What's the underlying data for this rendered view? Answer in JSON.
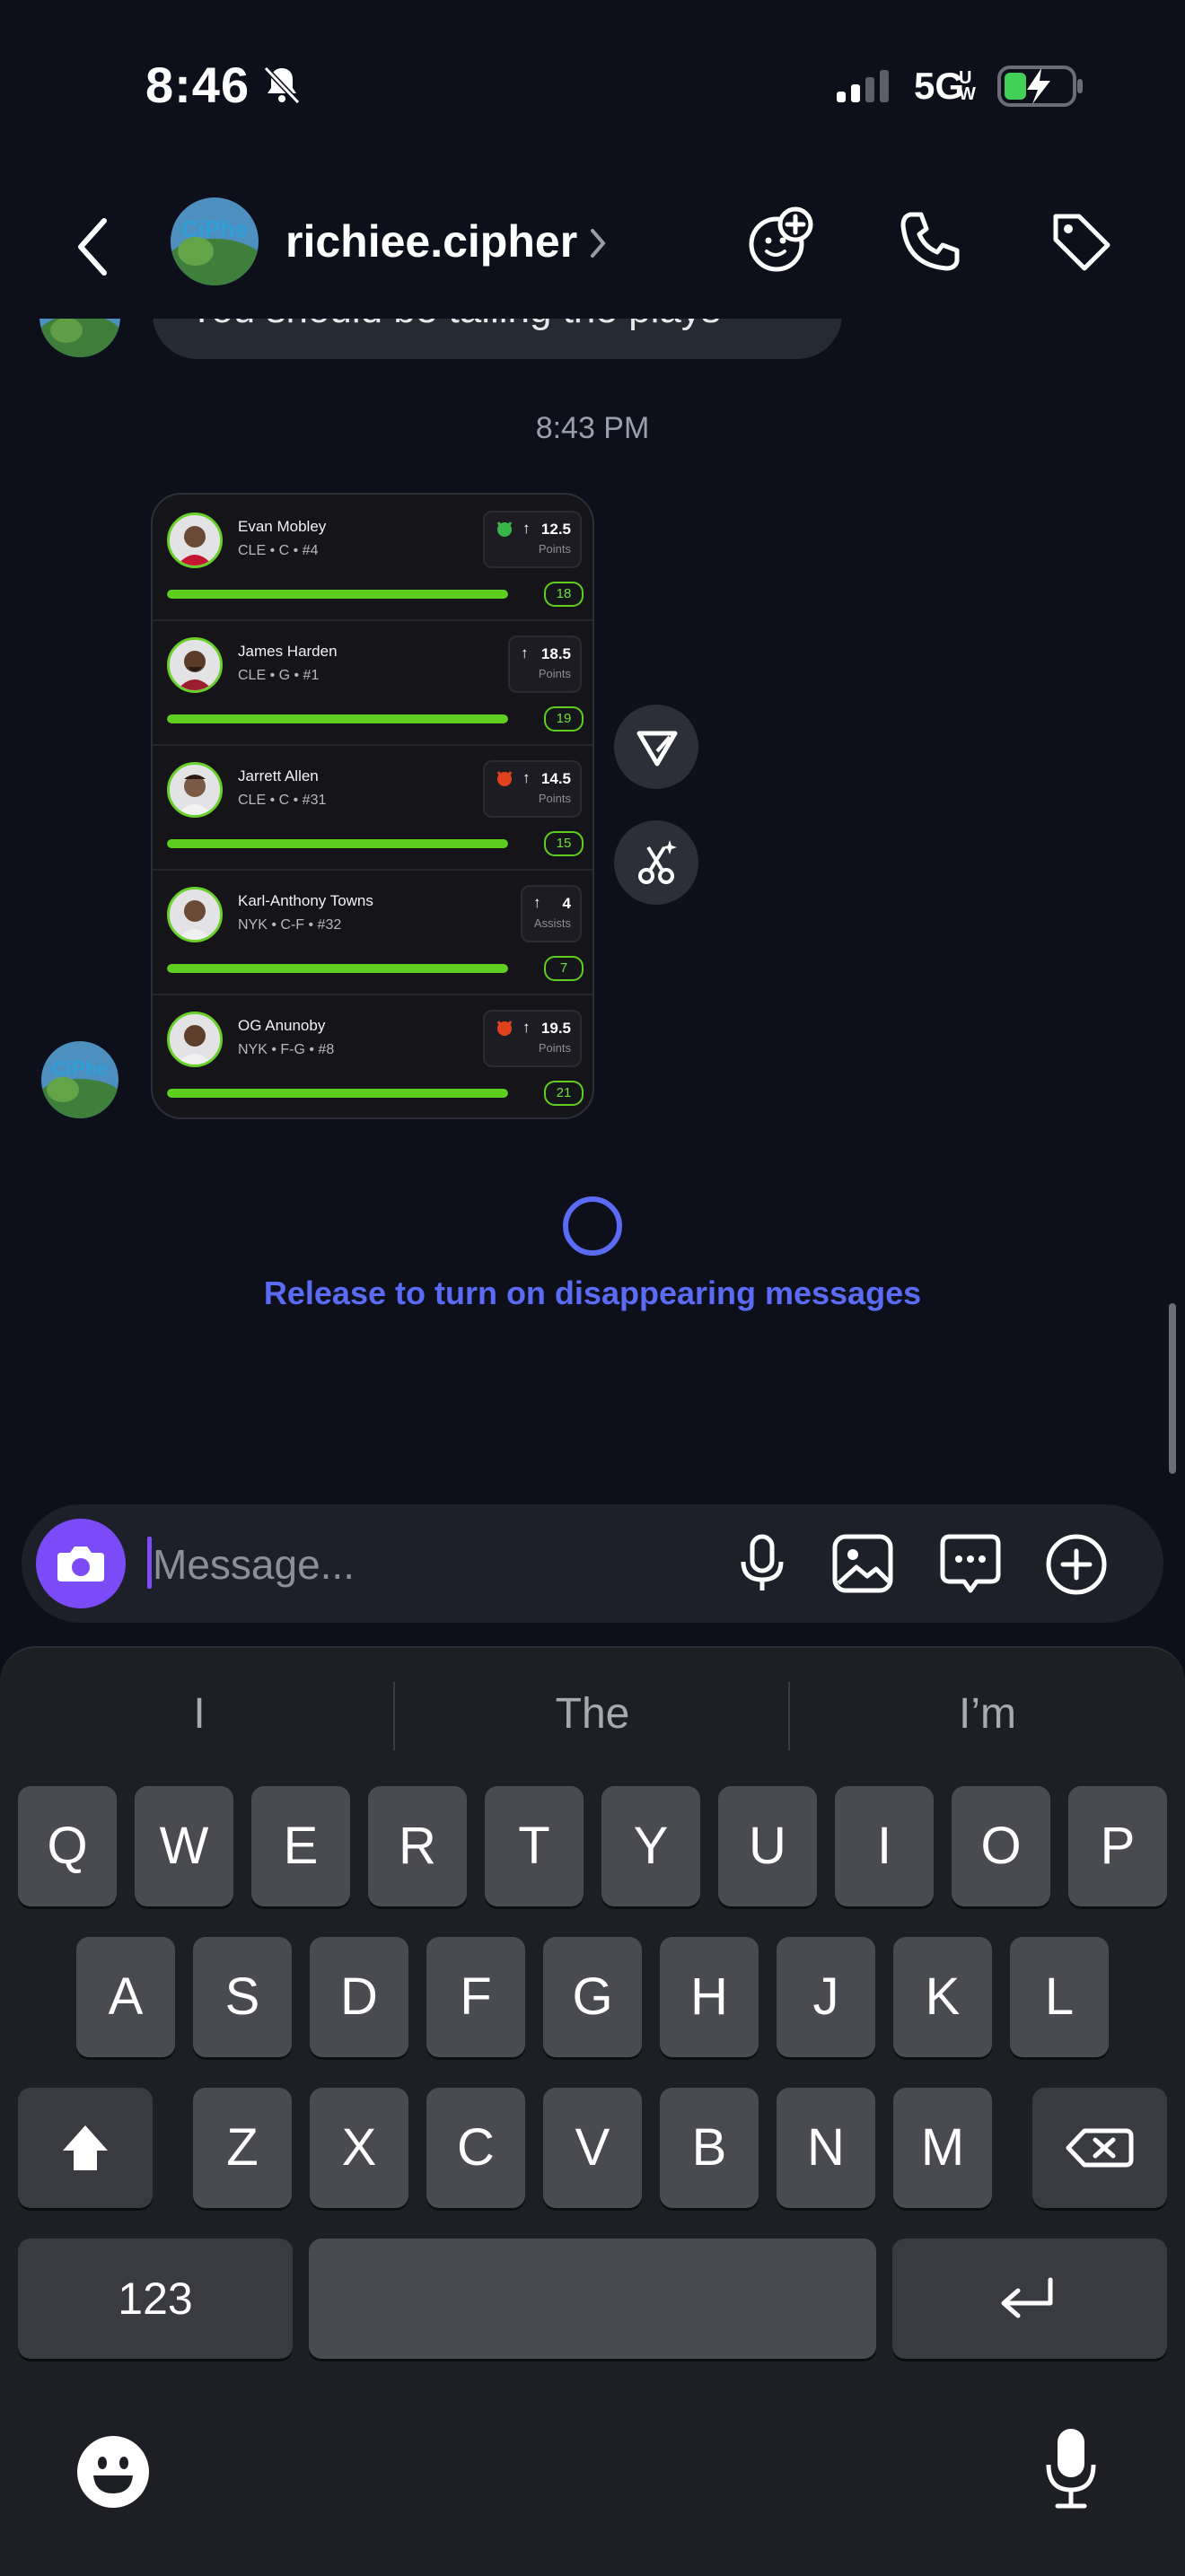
{
  "status_bar": {
    "time": "8:46",
    "network": "5G"
  },
  "header": {
    "contact_name": "richiee.cipher"
  },
  "chat": {
    "previous_message": "You should be tailing the plays",
    "timestamp": "8:43 PM",
    "player_card": [
      {
        "name": "Evan Mobley",
        "meta": "CLE • C • #4",
        "stat_value": "12.5",
        "stat_label": "Points",
        "emoji": "green-devil",
        "current": "18",
        "progress": 1.0
      },
      {
        "name": "James Harden",
        "meta": "CLE • G • #1",
        "stat_value": "18.5",
        "stat_label": "Points",
        "emoji": "",
        "current": "19",
        "progress": 1.0
      },
      {
        "name": "Jarrett Allen",
        "meta": "CLE • C • #31",
        "stat_value": "14.5",
        "stat_label": "Points",
        "emoji": "red-devil",
        "current": "15",
        "progress": 1.0
      },
      {
        "name": "Karl-Anthony Towns",
        "meta": "NYK • C-F • #32",
        "stat_value": "4",
        "stat_label": "Assists",
        "emoji": "",
        "current": "7",
        "progress": 1.0
      },
      {
        "name": "OG Anunoby",
        "meta": "NYK • F-G • #8",
        "stat_value": "19.5",
        "stat_label": "Points",
        "emoji": "red-devil",
        "current": "21",
        "progress": 1.0
      }
    ],
    "disappearing_prompt": "Release to turn on disappearing messages"
  },
  "composer": {
    "placeholder": "Message..."
  },
  "keyboard": {
    "suggestions": [
      "I",
      "The",
      "I’m"
    ],
    "row1": [
      "Q",
      "W",
      "E",
      "R",
      "T",
      "Y",
      "U",
      "I",
      "O",
      "P"
    ],
    "row2": [
      "A",
      "S",
      "D",
      "F",
      "G",
      "H",
      "J",
      "K",
      "L"
    ],
    "row3": [
      "Z",
      "X",
      "C",
      "V",
      "B",
      "N",
      "M"
    ],
    "numbers_label": "123"
  },
  "colors": {
    "background": "#0d101a",
    "accent_purple": "#7a4bf6",
    "progress_green": "#5fcf1f",
    "prompt_blue": "#5a6bf5"
  }
}
